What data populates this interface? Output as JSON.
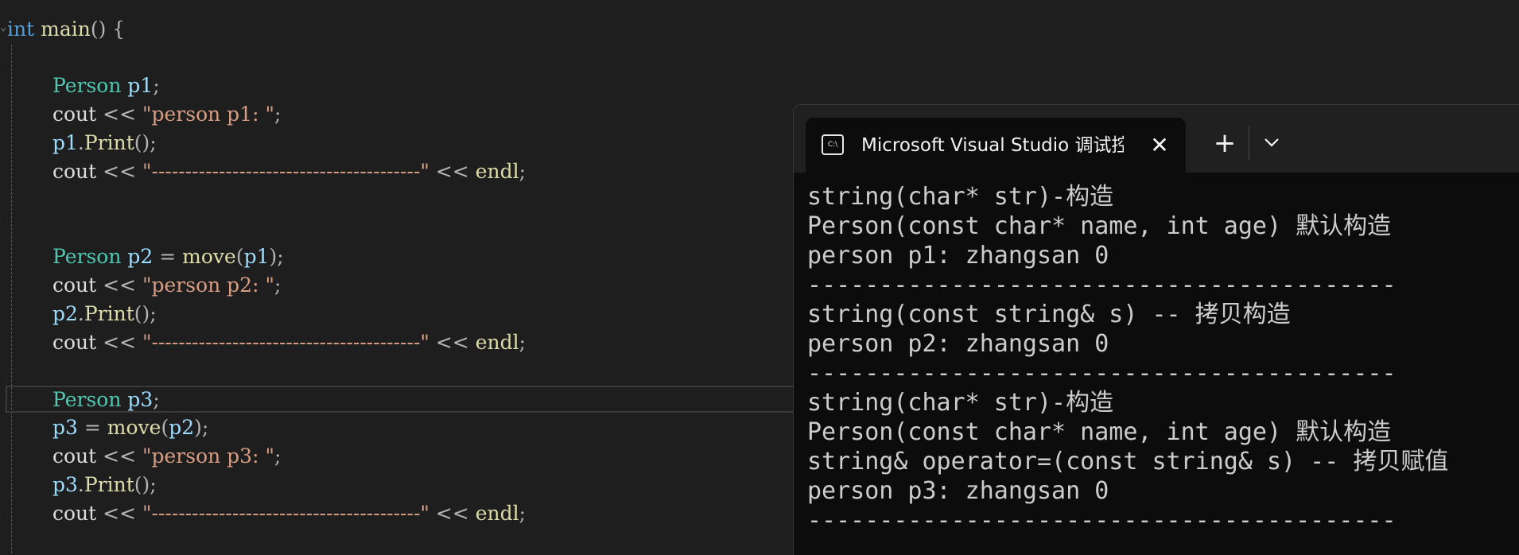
{
  "editor": {
    "lines": [
      [
        {
          "t": "int",
          "c": "kw"
        },
        {
          "t": " ",
          "c": "pl"
        },
        {
          "t": "main",
          "c": "fn"
        },
        {
          "t": "() {",
          "c": "op"
        }
      ],
      [
        {
          "t": "Person",
          "c": "ty"
        },
        {
          "t": " ",
          "c": "pl"
        },
        {
          "t": "p1",
          "c": "var"
        },
        {
          "t": ";",
          "c": "op"
        }
      ],
      [
        {
          "t": "cout",
          "c": "pl"
        },
        {
          "t": " << ",
          "c": "op"
        },
        {
          "t": "\"person p1: \"",
          "c": "str"
        },
        {
          "t": ";",
          "c": "op"
        }
      ],
      [
        {
          "t": "p1",
          "c": "var"
        },
        {
          "t": ".",
          "c": "op"
        },
        {
          "t": "Print",
          "c": "fn"
        },
        {
          "t": "();",
          "c": "op"
        }
      ],
      [
        {
          "t": "cout",
          "c": "pl"
        },
        {
          "t": " << ",
          "c": "op"
        },
        {
          "t": "\"----------------------------------------\"",
          "c": "str"
        },
        {
          "t": " << ",
          "c": "op"
        },
        {
          "t": "endl",
          "c": "fn"
        },
        {
          "t": ";",
          "c": "op"
        }
      ],
      [
        {
          "t": "Person",
          "c": "ty"
        },
        {
          "t": " ",
          "c": "pl"
        },
        {
          "t": "p2",
          "c": "var"
        },
        {
          "t": " = ",
          "c": "op"
        },
        {
          "t": "move",
          "c": "fn"
        },
        {
          "t": "(",
          "c": "op"
        },
        {
          "t": "p1",
          "c": "var"
        },
        {
          "t": ");",
          "c": "op"
        }
      ],
      [
        {
          "t": "cout",
          "c": "pl"
        },
        {
          "t": " << ",
          "c": "op"
        },
        {
          "t": "\"person p2: \"",
          "c": "str"
        },
        {
          "t": ";",
          "c": "op"
        }
      ],
      [
        {
          "t": "p2",
          "c": "var"
        },
        {
          "t": ".",
          "c": "op"
        },
        {
          "t": "Print",
          "c": "fn"
        },
        {
          "t": "();",
          "c": "op"
        }
      ],
      [
        {
          "t": "cout",
          "c": "pl"
        },
        {
          "t": " << ",
          "c": "op"
        },
        {
          "t": "\"----------------------------------------\"",
          "c": "str"
        },
        {
          "t": " << ",
          "c": "op"
        },
        {
          "t": "endl",
          "c": "fn"
        },
        {
          "t": ";",
          "c": "op"
        }
      ],
      [
        {
          "t": "Person",
          "c": "ty"
        },
        {
          "t": " ",
          "c": "pl"
        },
        {
          "t": "p3",
          "c": "var"
        },
        {
          "t": ";",
          "c": "op"
        }
      ],
      [
        {
          "t": "p3",
          "c": "var"
        },
        {
          "t": " = ",
          "c": "op"
        },
        {
          "t": "move",
          "c": "fn"
        },
        {
          "t": "(",
          "c": "op"
        },
        {
          "t": "p2",
          "c": "var"
        },
        {
          "t": ");",
          "c": "op"
        }
      ],
      [
        {
          "t": "cout",
          "c": "pl"
        },
        {
          "t": " << ",
          "c": "op"
        },
        {
          "t": "\"person p3: \"",
          "c": "str"
        },
        {
          "t": ";",
          "c": "op"
        }
      ],
      [
        {
          "t": "p3",
          "c": "var"
        },
        {
          "t": ".",
          "c": "op"
        },
        {
          "t": "Print",
          "c": "fn"
        },
        {
          "t": "();",
          "c": "op"
        }
      ],
      [
        {
          "t": "cout",
          "c": "pl"
        },
        {
          "t": " << ",
          "c": "op"
        },
        {
          "t": "\"----------------------------------------\"",
          "c": "str"
        },
        {
          "t": " << ",
          "c": "op"
        },
        {
          "t": "endl",
          "c": "fn"
        },
        {
          "t": ";",
          "c": "op"
        }
      ]
    ]
  },
  "terminal": {
    "tab_icon_text": "C:\\",
    "tab_title": "Microsoft Visual Studio 调试控制台",
    "close_glyph": "✕",
    "new_tab_glyph": "+",
    "output": [
      "string(char* str)-构造",
      "Person(const char* name, int age) 默认构造",
      "person p1: zhangsan 0",
      "-----------------------------------------",
      "string(const string& s) -- 拷贝构造",
      "person p2: zhangsan 0",
      "-----------------------------------------",
      "string(char* str)-构造",
      "Person(const char* name, int age) 默认构造",
      "string& operator=(const string& s) -- 拷贝赋值",
      "person p3: zhangsan 0",
      "-----------------------------------------"
    ]
  },
  "colors": {
    "keyword": "#569cd6",
    "function": "#dcdcaa",
    "type": "#4ec9b0",
    "variable": "#9cdcfe",
    "string": "#d69d85",
    "editor_bg": "#1e1e1e",
    "terminal_bg": "#0c0c0c"
  }
}
